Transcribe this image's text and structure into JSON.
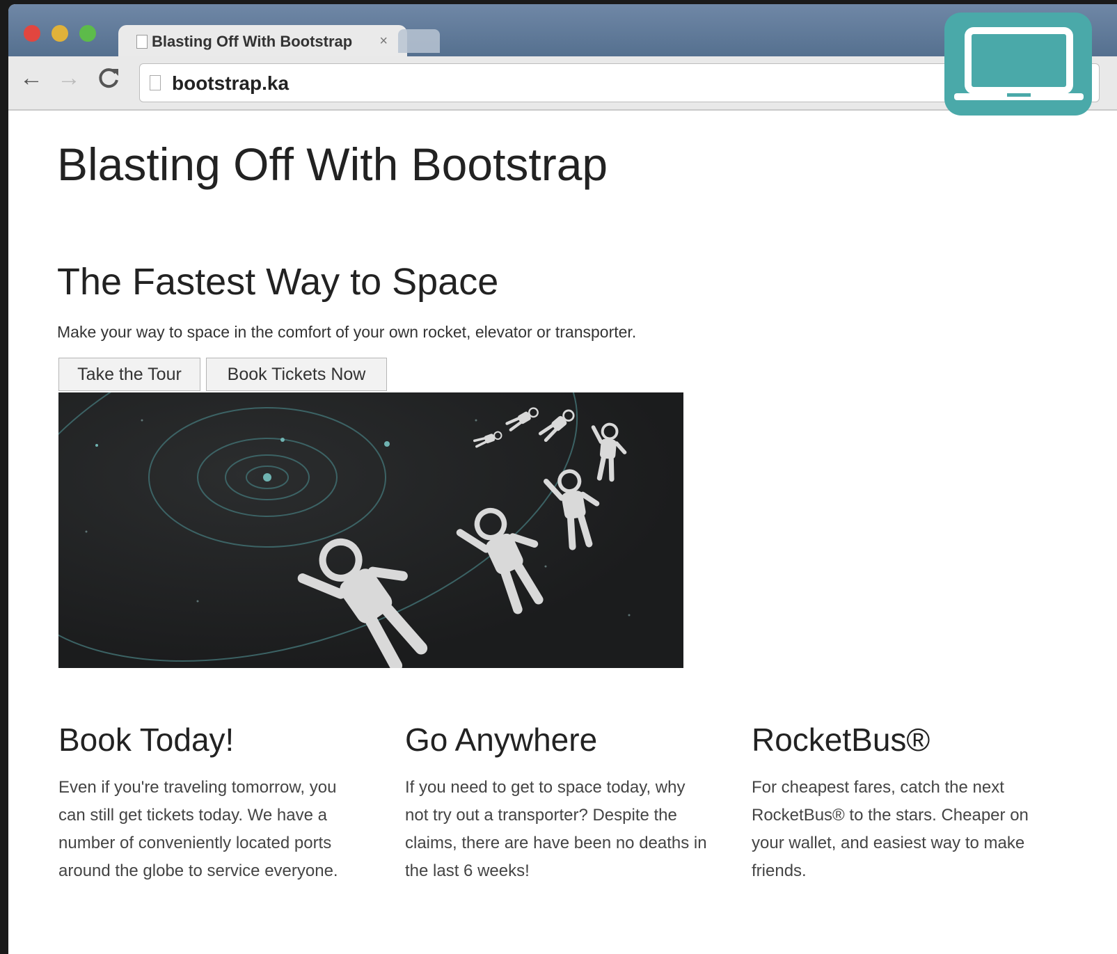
{
  "browser": {
    "tab_title": "Blasting Off With Bootstrap",
    "tab_close": "×",
    "url": "bootstrap.ka"
  },
  "page": {
    "site_title": "Blasting Off With Bootstrap",
    "hero": {
      "heading": "The Fastest Way to Space",
      "text": "Make your way to space in the comfort of your own rocket, elevator or transporter.",
      "buttons": [
        "Take the Tour",
        "Book Tickets Now"
      ]
    },
    "columns": [
      {
        "heading": "Book Today!",
        "text": "Even if you're traveling tomorrow, you can still get tickets today. We have a number of conveniently located ports around the globe to service everyone."
      },
      {
        "heading": "Go Anywhere",
        "text": "If you need to get to space today, why not try out a transporter? Despite the claims, there are have been no deaths in the last 6 weeks!"
      },
      {
        "heading": "RocketBus®",
        "text": "For cheapest fares, catch the next RocketBus® to the stars. Cheaper on your wallet, and easiest way to make friends."
      }
    ]
  },
  "icons": {
    "back": "arrow-left-icon",
    "forward": "arrow-right-icon",
    "reload": "reload-icon",
    "device": "laptop-icon"
  },
  "colors": {
    "tabstrip": "#5f7a99",
    "device_badge": "#4aa9a9",
    "hero_image_bg": "#1e1f20"
  }
}
